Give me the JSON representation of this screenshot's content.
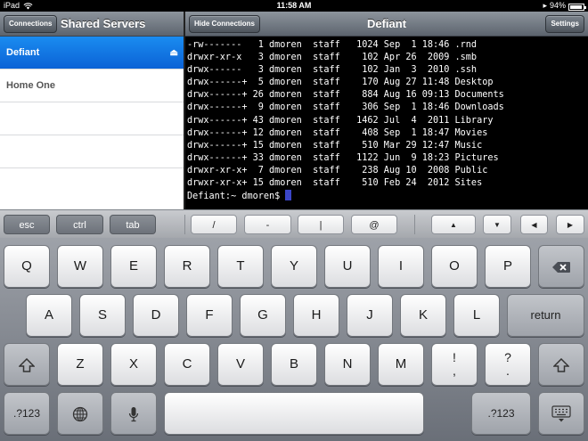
{
  "status": {
    "device": "iPad",
    "time": "11:58 AM",
    "battery": "94%",
    "battery_level": 0.94
  },
  "left": {
    "connections_button": "Connections",
    "title": "Shared Servers",
    "servers": [
      {
        "name": "Defiant",
        "selected": true
      },
      {
        "name": "Home One",
        "selected": false
      }
    ]
  },
  "right": {
    "hide_button": "Hide Connections",
    "title": "Defiant",
    "settings_button": "Settings"
  },
  "terminal": {
    "lines": [
      "-rw-------   1 dmoren  staff   1024 Sep  1 18:46 .rnd",
      "drwxr-xr-x   3 dmoren  staff    102 Apr 26  2009 .smb",
      "drwx------   3 dmoren  staff    102 Jan  3  2010 .ssh",
      "drwx------+  5 dmoren  staff    170 Aug 27 11:48 Desktop",
      "drwx------+ 26 dmoren  staff    884 Aug 16 09:13 Documents",
      "drwx------+  9 dmoren  staff    306 Sep  1 18:46 Downloads",
      "drwx------+ 43 dmoren  staff   1462 Jul  4  2011 Library",
      "drwx------+ 12 dmoren  staff    408 Sep  1 18:47 Movies",
      "drwx------+ 15 dmoren  staff    510 Mar 29 12:47 Music",
      "drwx------+ 33 dmoren  staff   1122 Jun  9 18:23 Pictures",
      "drwxr-xr-x+  7 dmoren  staff    238 Aug 10  2008 Public",
      "drwxr-xr-x+ 15 dmoren  staff    510 Feb 24  2012 Sites"
    ],
    "prompt": "Defiant:~ dmoren$ "
  },
  "accessory": {
    "esc": "esc",
    "ctrl": "ctrl",
    "tab": "tab",
    "slash": "/",
    "dash": "-",
    "pipe": "|",
    "at": "@",
    "up": "▲",
    "down": "▼",
    "left": "◀",
    "right": "▶"
  },
  "keyboard": {
    "row1": [
      "Q",
      "W",
      "E",
      "R",
      "T",
      "Y",
      "U",
      "I",
      "O",
      "P"
    ],
    "row2": [
      "A",
      "S",
      "D",
      "F",
      "G",
      "H",
      "J",
      "K",
      "L"
    ],
    "row3": [
      "Z",
      "X",
      "C",
      "V",
      "B",
      "N",
      "M"
    ],
    "return": "return",
    "num_left": ".?123",
    "num_right": ".?123",
    "exclaim_top": "!",
    "exclaim_bottom": ",",
    "question_top": "?",
    "question_bottom": ".",
    "icons": [
      "backspace-icon",
      "shift-icon",
      "globe-icon",
      "microphone-icon",
      "keyboard-dismiss-icon"
    ]
  }
}
